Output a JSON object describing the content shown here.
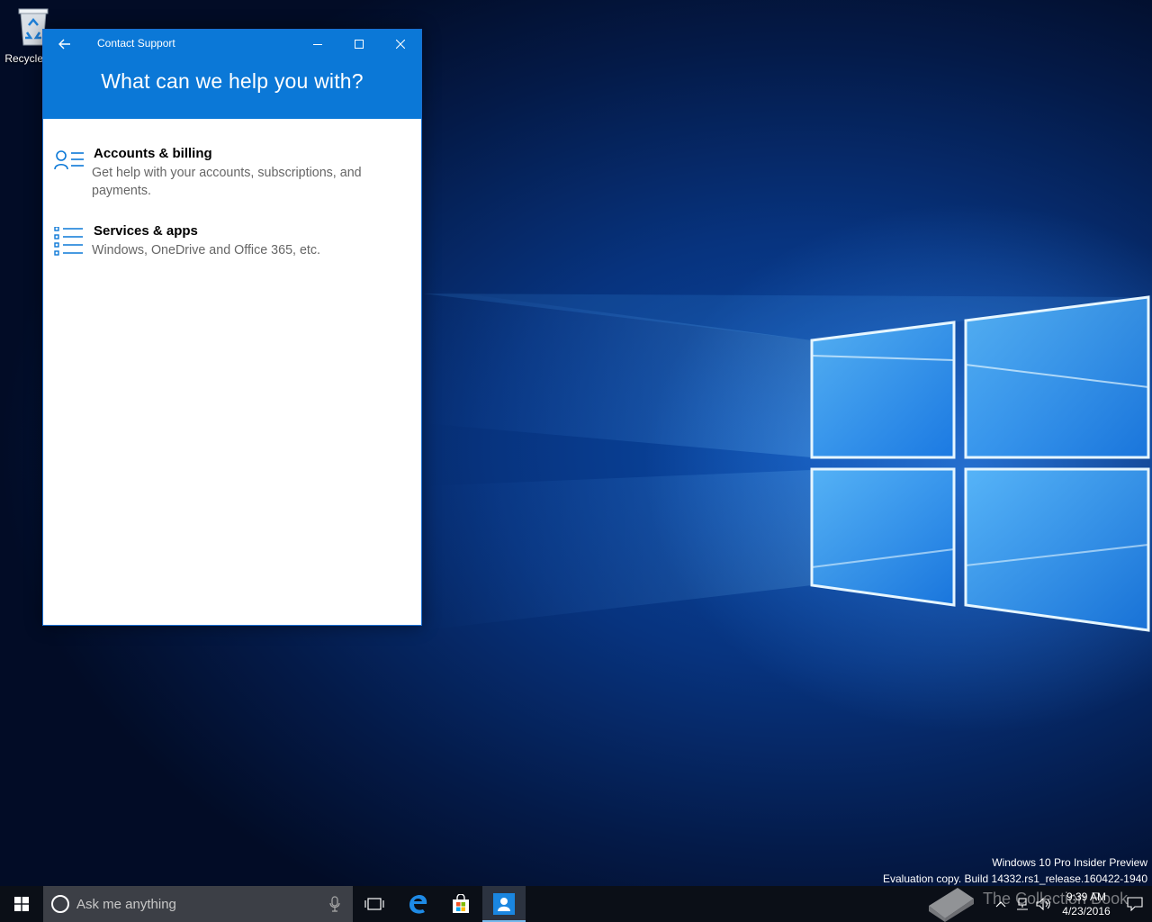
{
  "desktop": {
    "recycle_bin_label": "Recycle Bin"
  },
  "window": {
    "title": "Contact Support",
    "headline": "What can we help you with?",
    "topics": [
      {
        "icon": "person-list-icon",
        "title": "Accounts & billing",
        "description": "Get help with your accounts, subscriptions, and payments."
      },
      {
        "icon": "bullet-list-icon",
        "title": "Services & apps",
        "description": "Windows, OneDrive and Office 365, etc."
      }
    ],
    "accent_color": "#0b78d7"
  },
  "watermark": {
    "line1": "Windows 10 Pro Insider Preview",
    "line2": "Evaluation copy. Build 14332.rs1_release.160422-1940"
  },
  "taskbar": {
    "search_placeholder": "Ask me anything",
    "time": "9:39 AM",
    "date": "4/23/2016",
    "pinned": [
      "task-view-icon",
      "edge-icon",
      "store-icon",
      "contact-support-icon"
    ]
  },
  "overlay": {
    "text": "The Collection Book"
  }
}
